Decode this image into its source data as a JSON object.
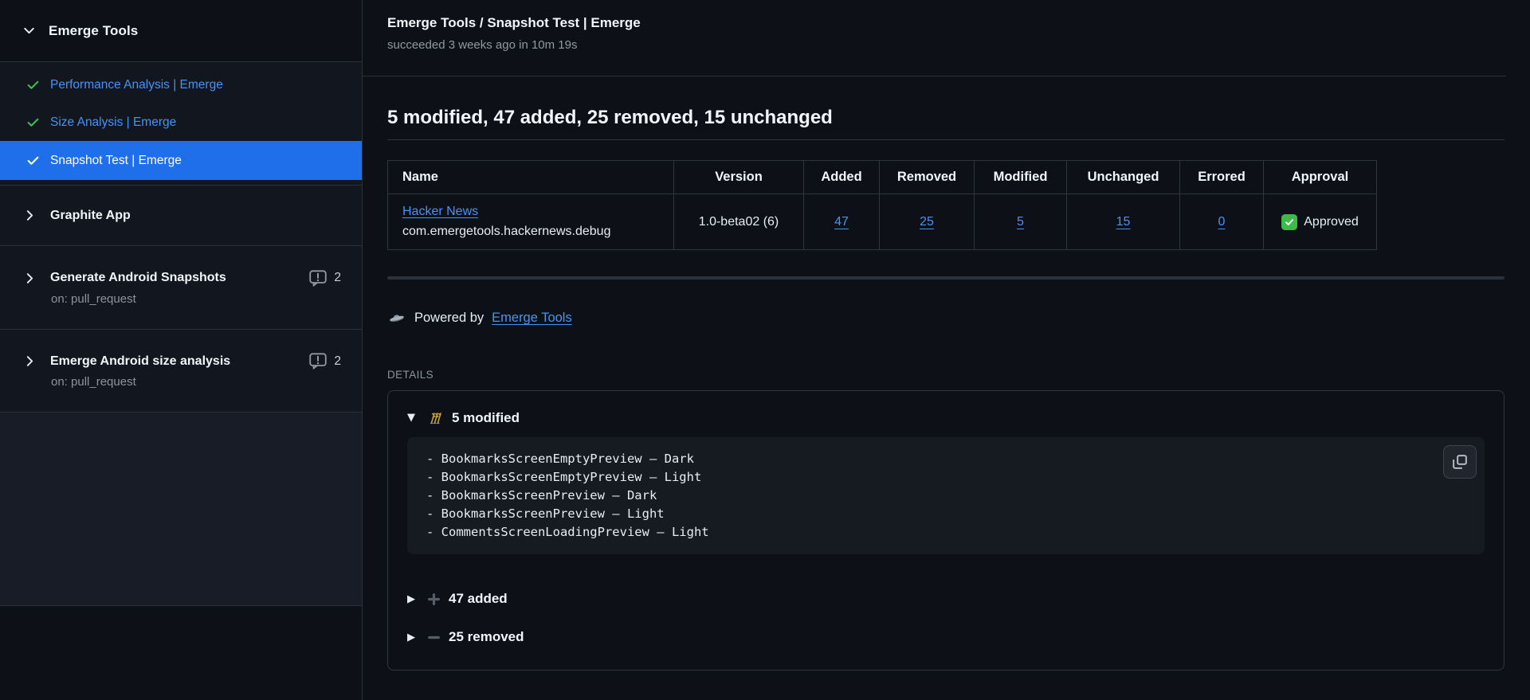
{
  "colors": {
    "accent_selected": "#1f6feb",
    "link_blue": "#4493f8",
    "success_green": "#3fb950",
    "modified_yellow": "#d4a72c",
    "approved_green": "#3dbb4a",
    "background": "#0d1117",
    "border": "#30363d"
  },
  "sidebar": {
    "title": "Emerge Tools",
    "check_runs": [
      {
        "label": "Performance Analysis | Emerge",
        "status": "success"
      },
      {
        "label": "Size Analysis | Emerge",
        "status": "success"
      },
      {
        "label": "Snapshot Test | Emerge",
        "status": "success",
        "selected": true
      }
    ],
    "app_sections": [
      {
        "label": "Graphite App"
      }
    ],
    "workflows": [
      {
        "label": "Generate Android Snapshots",
        "trigger": "on: pull_request",
        "annotations": "2"
      },
      {
        "label": "Emerge Android size analysis",
        "trigger": "on: pull_request",
        "annotations": "2"
      }
    ]
  },
  "header": {
    "title": "Emerge Tools / Snapshot Test | Emerge",
    "status_line": "succeeded 3 weeks ago in 10m 19s"
  },
  "report": {
    "summary_heading": "5 modified, 47 added, 25 removed, 15 unchanged",
    "table": {
      "columns": [
        "Name",
        "Version",
        "Added",
        "Removed",
        "Modified",
        "Unchanged",
        "Errored",
        "Approval"
      ],
      "row": {
        "name": "Hacker News",
        "bundle_id": "com.emergetools.hackernews.debug",
        "version": "1.0-beta02 (6)",
        "added": "47",
        "removed": "25",
        "modified": "5",
        "unchanged": "15",
        "errored": "0",
        "approval": "Approved"
      }
    },
    "powered_by": {
      "prefix": "Powered by",
      "link_label": "Emerge Tools"
    }
  },
  "details": {
    "label": "DETAILS",
    "modified": {
      "title": "5 modified",
      "items": [
        "- BookmarksScreenEmptyPreview — Dark",
        "- BookmarksScreenEmptyPreview — Light",
        "- BookmarksScreenPreview — Dark",
        "- BookmarksScreenPreview — Light",
        "- CommentsScreenLoadingPreview — Light"
      ]
    },
    "added": {
      "title": "47 added"
    },
    "removed": {
      "title": "25 removed"
    }
  }
}
